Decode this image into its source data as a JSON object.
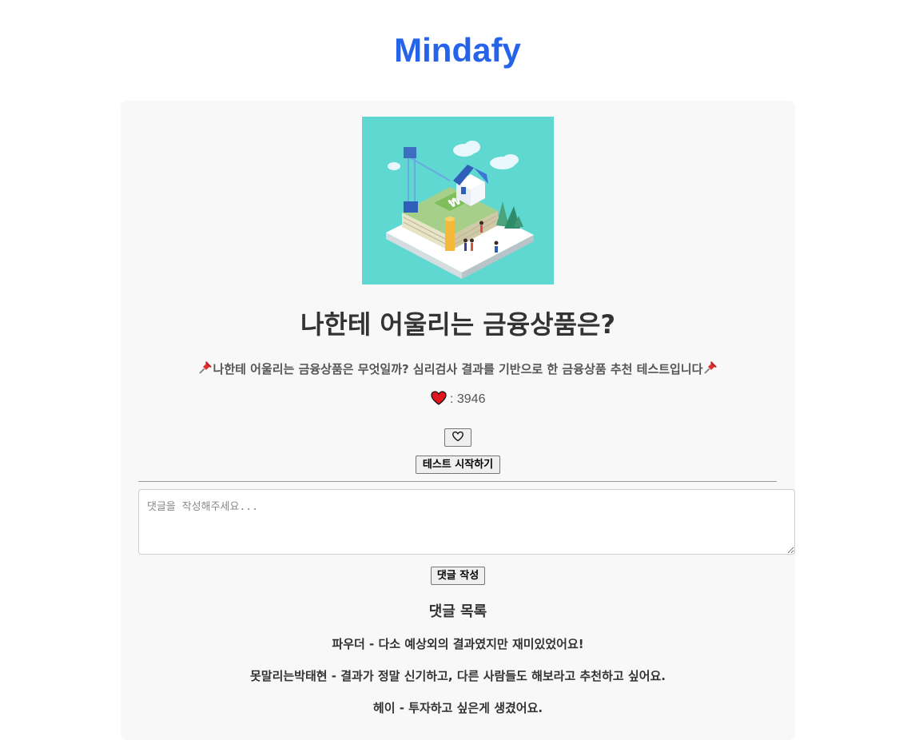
{
  "header": {
    "brand": "Mindafy"
  },
  "test": {
    "title": "나한테 어울리는 금융상품은?",
    "description": "나한테 어울리는 금융상품은 무엇일까? 심리검사 결과를 기반으로 한 금융상품 추천 테스트입니다",
    "like_count_text": ": 3946",
    "pin_icon": "pushpin-icon",
    "heart_icon": "heart-icon",
    "hero_image": "isometric-house-money-illustration"
  },
  "actions": {
    "like_icon": "heart-outline-icon",
    "start_label": "테스트 시작하기"
  },
  "comment_form": {
    "placeholder": "댓글을 작성해주세요...",
    "submit_label": "댓글 작성"
  },
  "comments": {
    "title": "댓글 목록",
    "items": [
      {
        "text": "파우더 - 다소 예상외의 결과였지만 재미있었어요!"
      },
      {
        "text": "못말리는박태현 - 결과가 정말 신기하고, 다른 사람들도 해보라고 추천하고 싶어요."
      },
      {
        "text": "헤이 - 투자하고 싶은게 생겼어요."
      }
    ]
  },
  "colors": {
    "brand": "#2563eb",
    "hero_bg": "#5fd8d2",
    "card_bg": "#f8f8f8"
  }
}
